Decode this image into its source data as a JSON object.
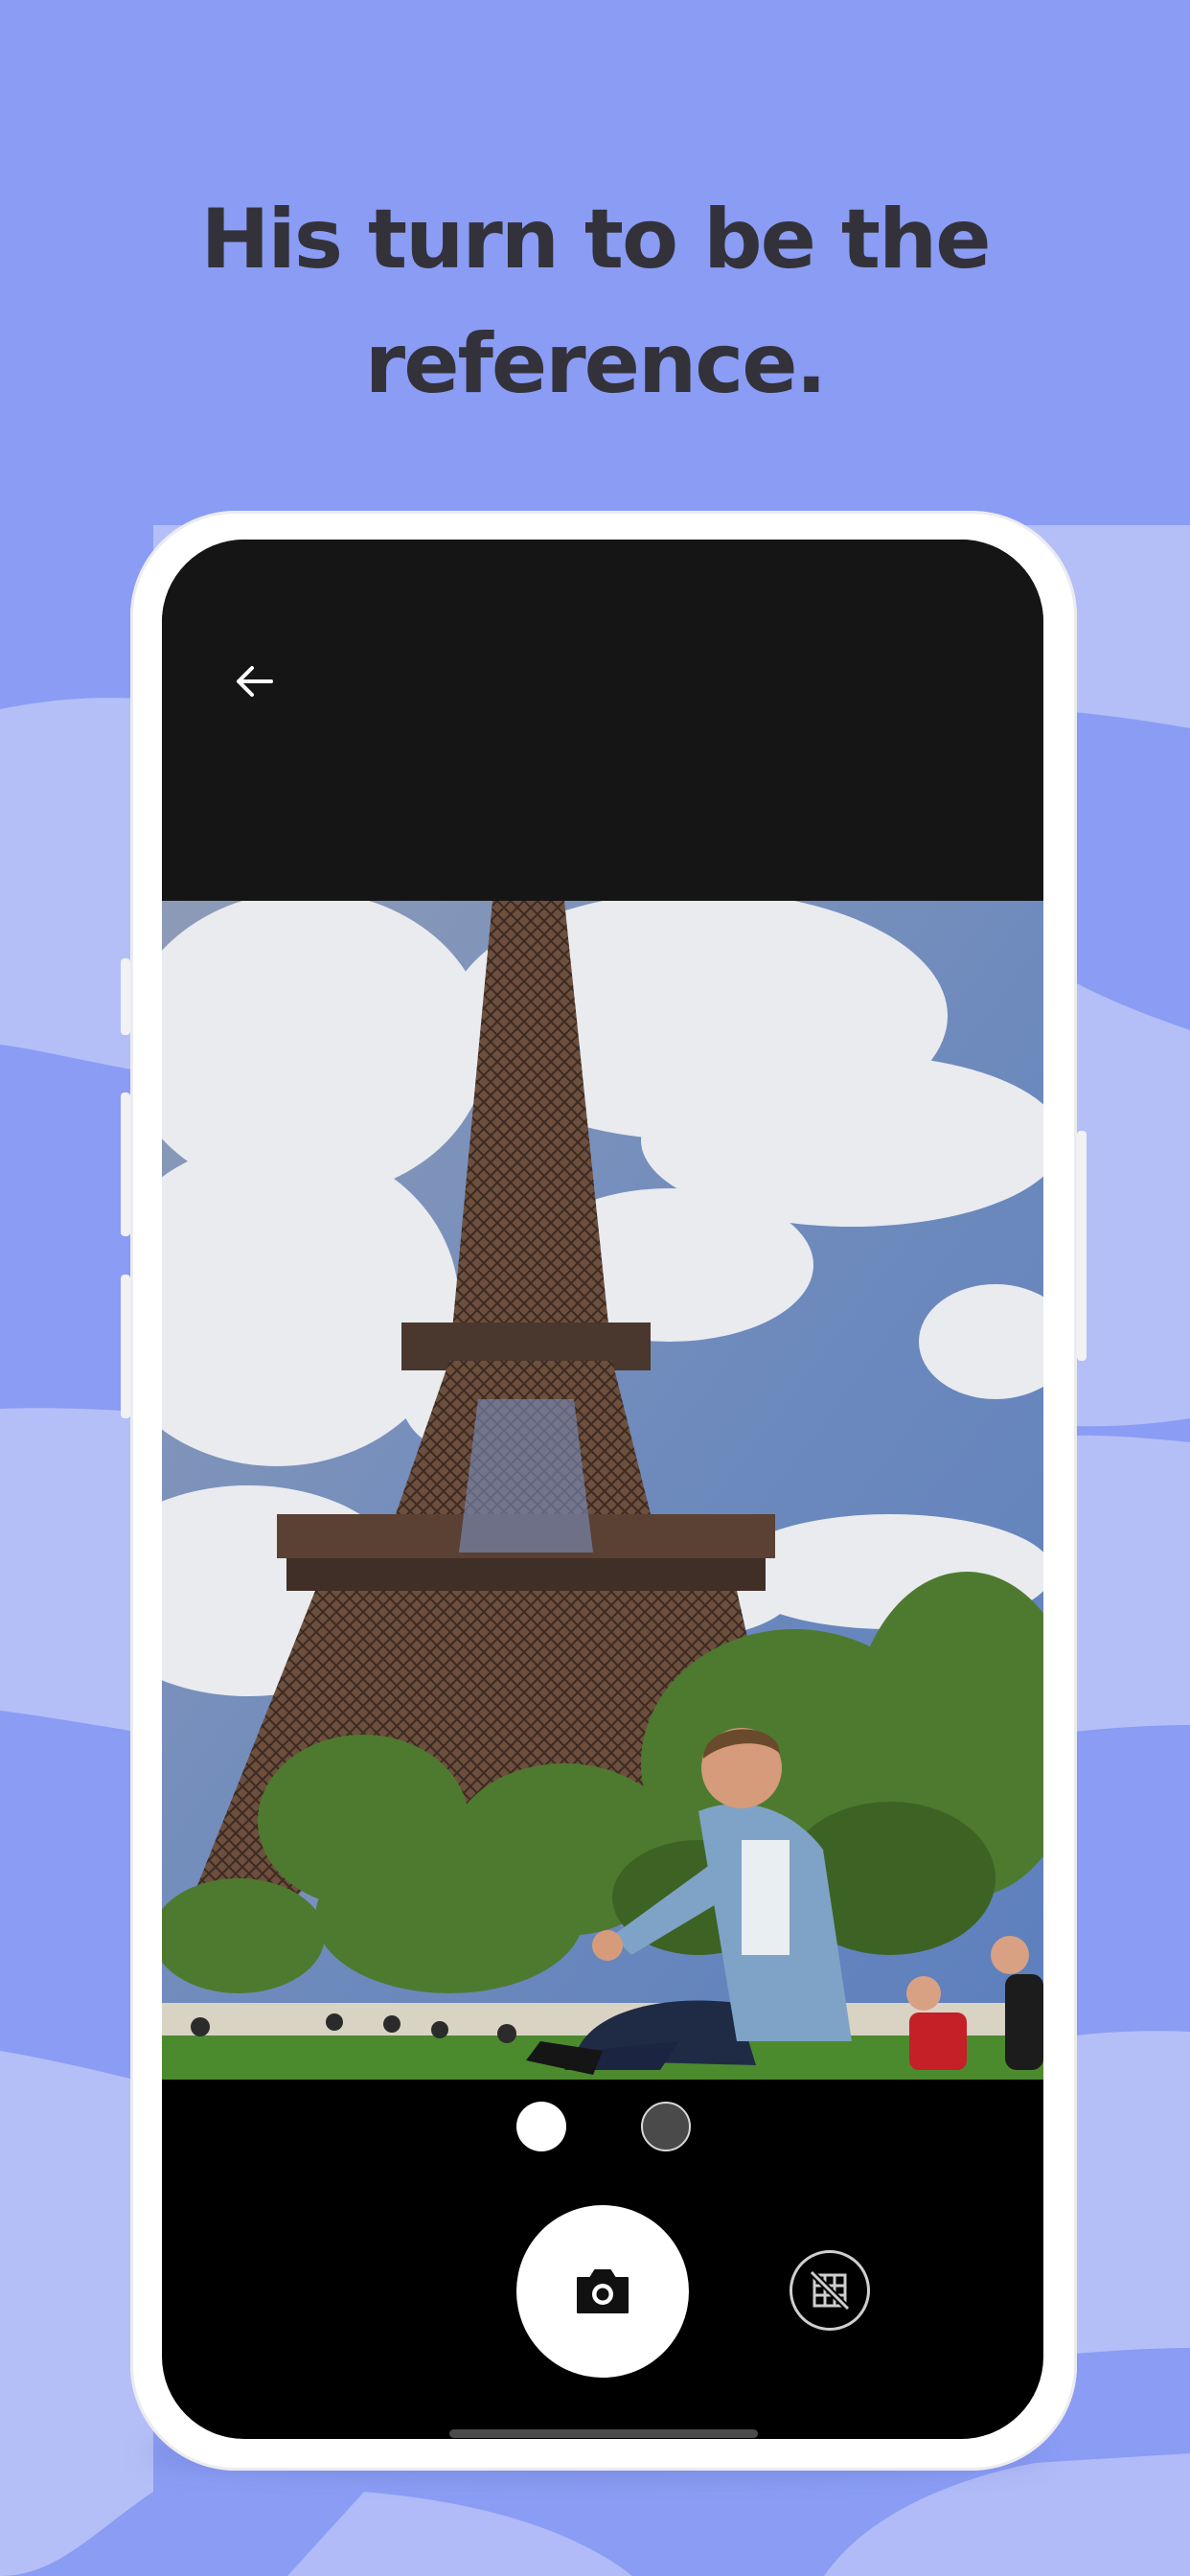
{
  "headline": {
    "line1": "His turn to be the",
    "line2": "reference."
  },
  "colors": {
    "background": "#8a9cf4",
    "pattern_light": "#b4bff7",
    "headline_text": "#33323a",
    "phone_frame": "#ffffff",
    "camera_bar": "#151515"
  },
  "camera": {
    "back_icon": "arrow-left-icon",
    "photo": "eiffel-tower-man-sitting-on-grass",
    "pager": {
      "pages": 2,
      "active_index": 0
    },
    "shutter_icon": "camera-icon",
    "grid_toggle_icon": "grid-off-icon"
  }
}
